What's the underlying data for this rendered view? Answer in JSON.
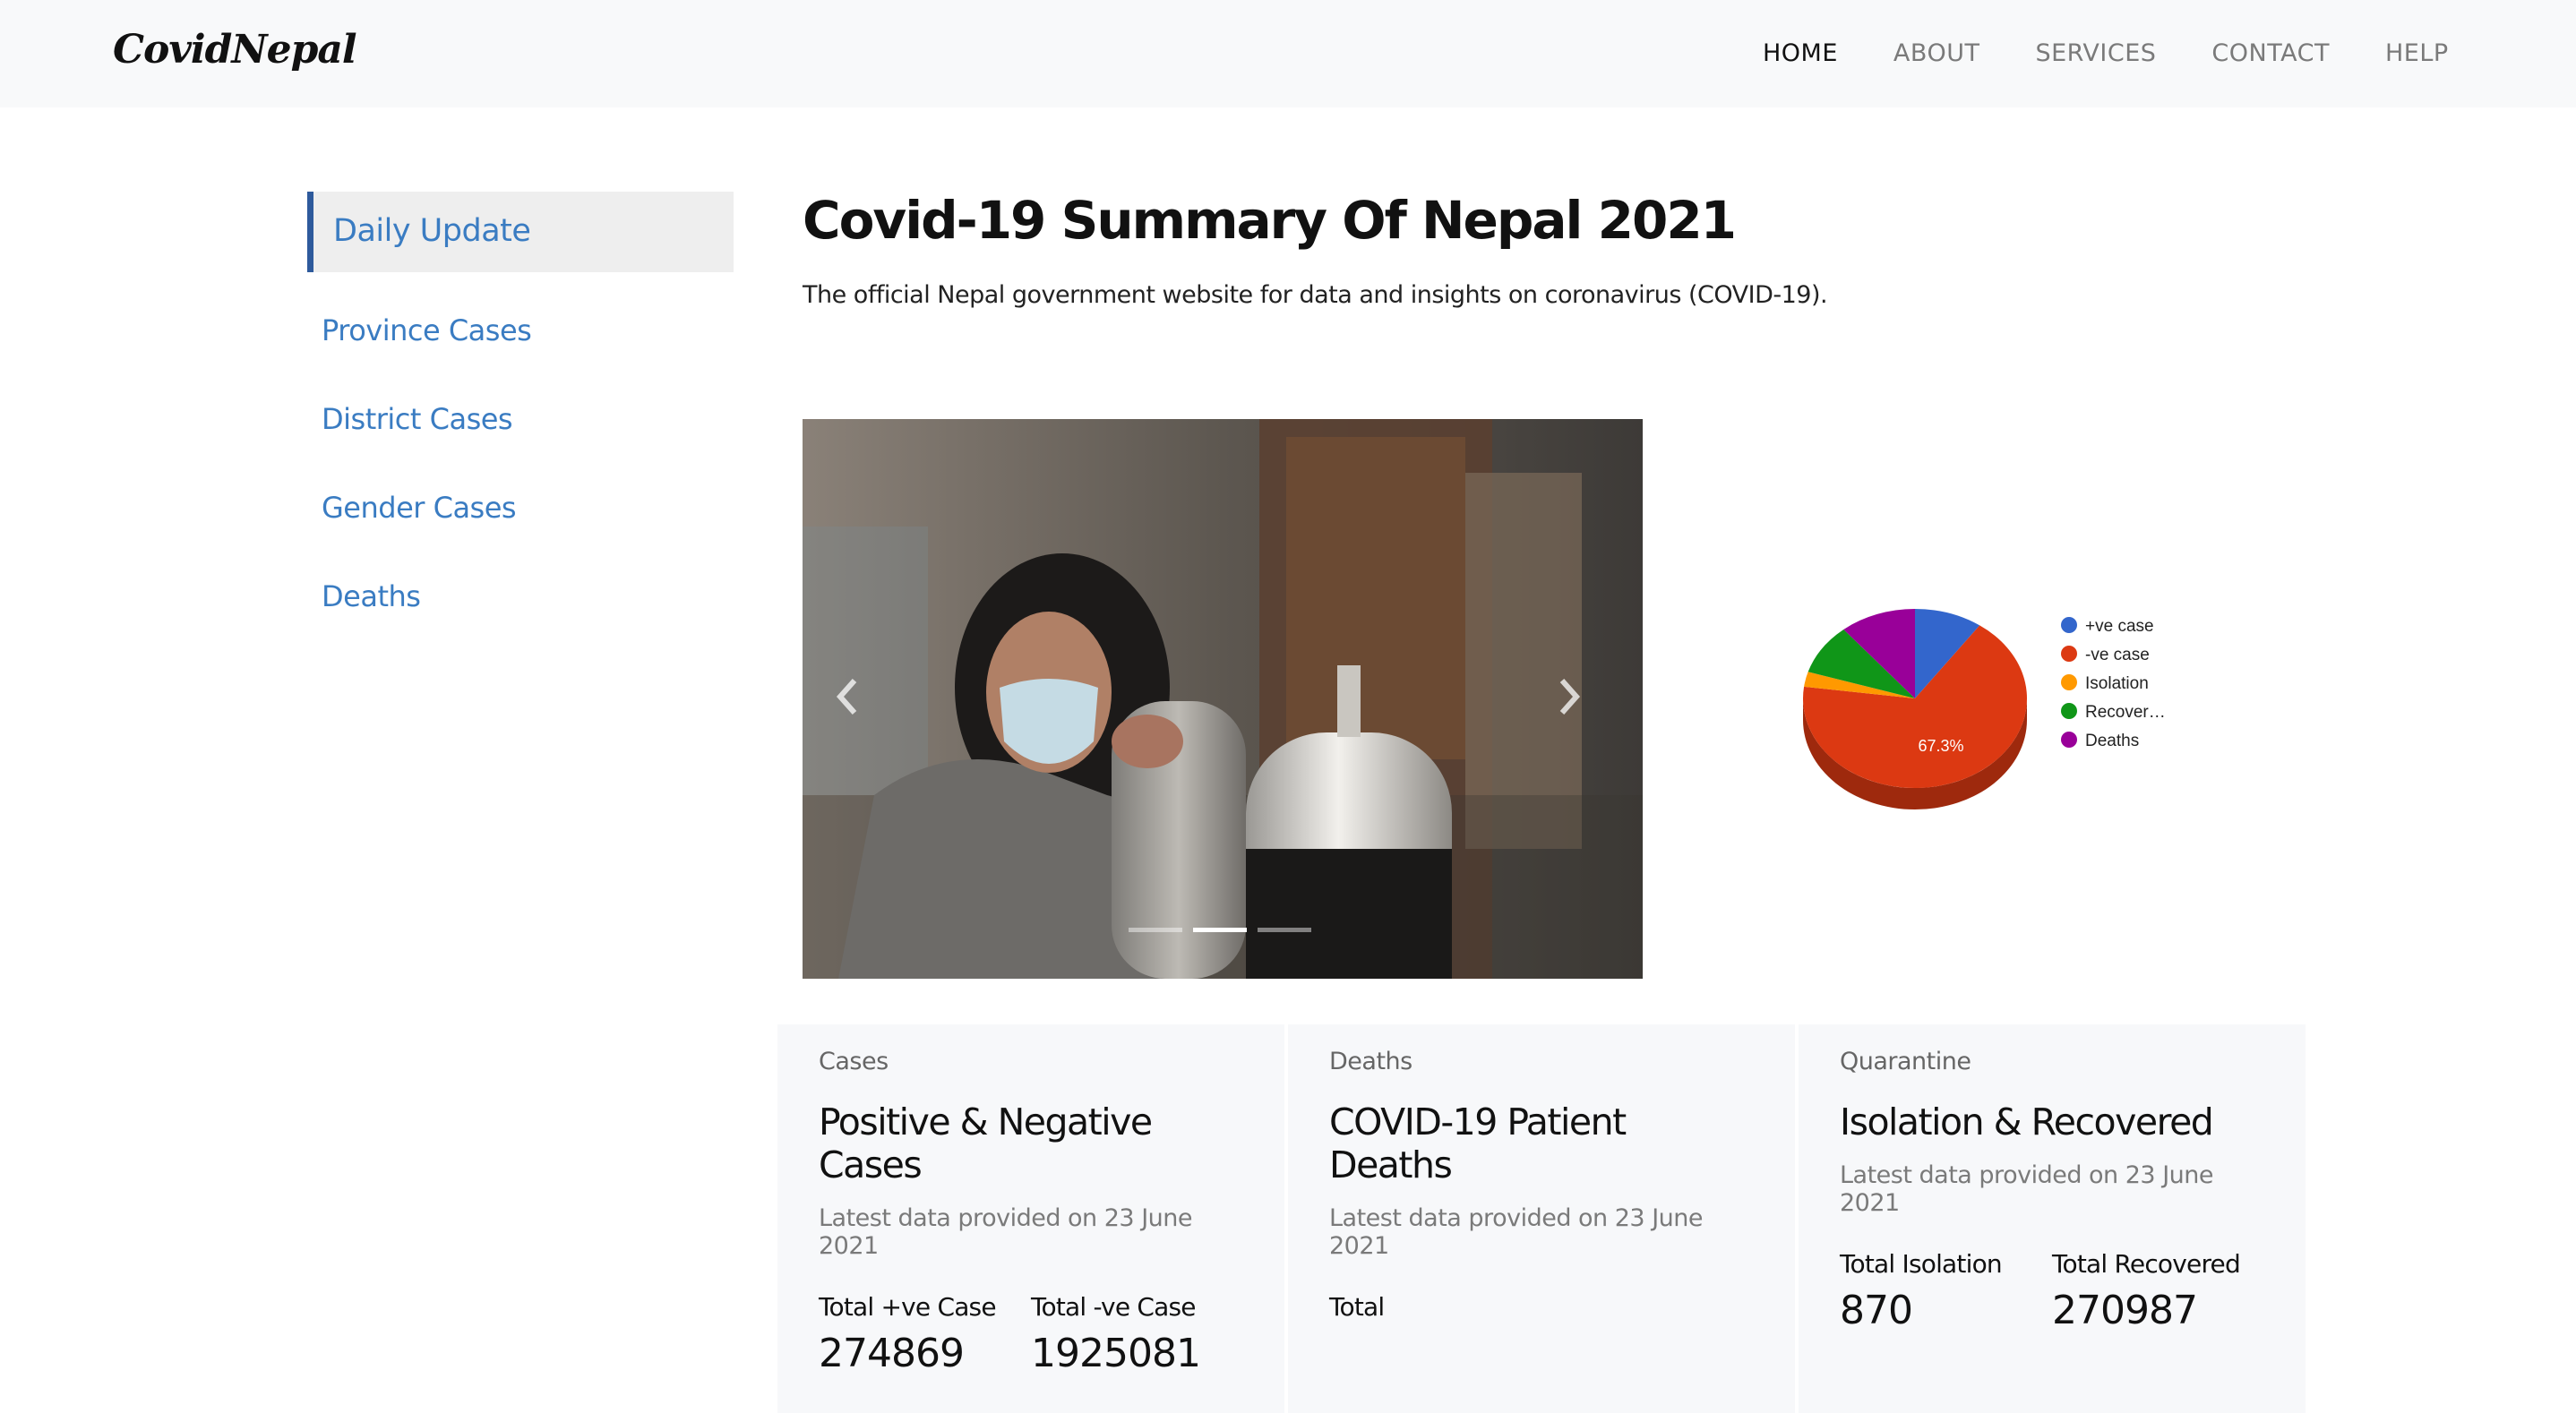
{
  "brand": "CovidNepal",
  "nav": {
    "items": [
      "HOME",
      "ABOUT",
      "SERVICES",
      "CONTACT",
      "HELP"
    ],
    "active": "HOME"
  },
  "sidebar": {
    "items": [
      {
        "label": "Daily Update"
      },
      {
        "label": "Province Cases"
      },
      {
        "label": "District Cases"
      },
      {
        "label": "Gender Cases"
      },
      {
        "label": "Deaths"
      }
    ]
  },
  "main": {
    "title": "Covid-19 Summary Of Nepal 2021",
    "subtitle": "The official Nepal government website for data and insights on coronavirus (COVID-19)."
  },
  "carousel": {
    "slide_count": 3,
    "active_index": 1
  },
  "chart_data": {
    "type": "pie",
    "labels": [
      "+ve case",
      "-ve case",
      "Isolation",
      "Recover…",
      "Deaths"
    ],
    "values": [
      9.8,
      67.3,
      2.7,
      9.2,
      11.0
    ],
    "colors": [
      "#3366cc",
      "#dc3912",
      "#ff9900",
      "#109618",
      "#990099"
    ],
    "slice_labels": [
      "",
      "67.3%",
      "",
      "",
      ""
    ],
    "legend": "right",
    "style": "3d"
  },
  "cards": [
    {
      "category": "Cases",
      "title": "Positive & Negative Cases",
      "updated": "Latest data provided on 23 June 2021",
      "stats": [
        {
          "label": "Total +ve Case",
          "value": "274869"
        },
        {
          "label": "Total -ve Case",
          "value": "1925081"
        }
      ]
    },
    {
      "category": "Deaths",
      "title": "COVID-19 Patient Deaths",
      "updated": "Latest data provided on 23 June 2021",
      "stats": [
        {
          "label": "Total",
          "value": ""
        }
      ]
    },
    {
      "category": "Quarantine",
      "title": "Isolation & Recovered",
      "updated": "Latest data provided on 23 June 2021",
      "stats": [
        {
          "label": "Total Isolation",
          "value": "870"
        },
        {
          "label": "Total Recovered",
          "value": "270987"
        }
      ]
    }
  ]
}
